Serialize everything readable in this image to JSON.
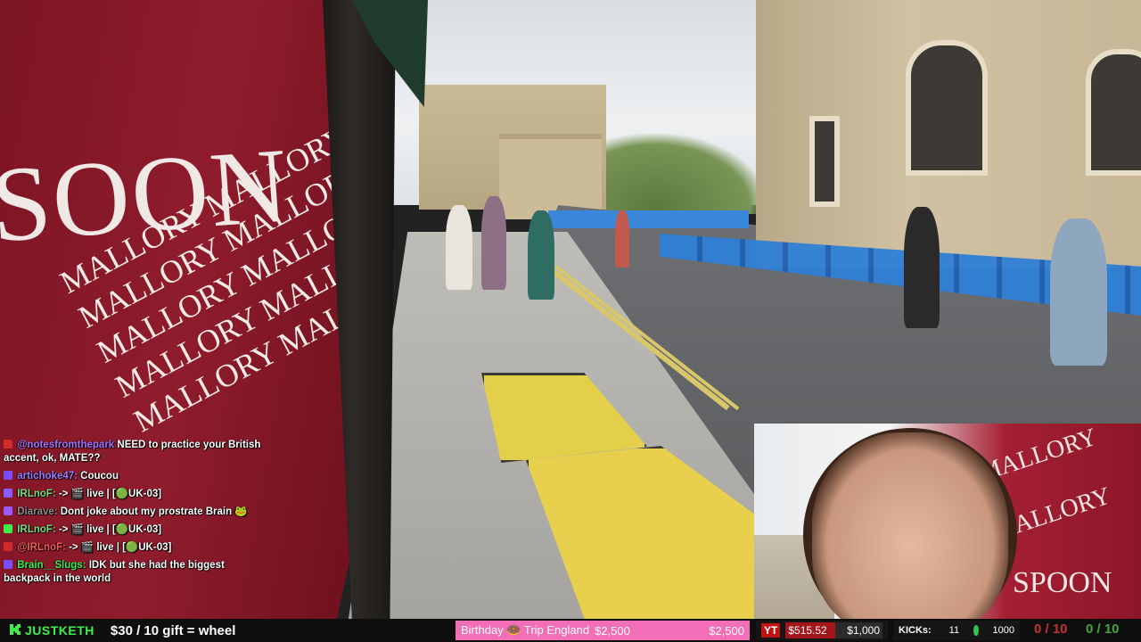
{
  "scene": {
    "ad_word": "SOON",
    "ad_row": "MALLORY MALLORY"
  },
  "webcam": {
    "wall_text_1": "MALLORY",
    "wall_text_2": "Y MALLORY",
    "wall_text_3": "SPOON"
  },
  "chat": [
    {
      "user": "@notesfromthepark",
      "user_color": "#a970ff",
      "message": "NEED to practice your British accent, ok, MATE??",
      "badge": "#d12b2b"
    },
    {
      "user": "artichoke47:",
      "user_color": "#9b7cff",
      "message": "Coucou",
      "badge": "#7a4cff"
    },
    {
      "user": "IRLnoF:",
      "user_color": "#7bdc7b",
      "message": "-> 🎬 live | [🟢UK-03]",
      "badge": "#8a5cff"
    },
    {
      "user": "Diarave:",
      "user_color": "#8b8b8b",
      "message": "Dont joke about my prostrate Brain 🐸",
      "badge": "#9b59ff"
    },
    {
      "user": "IRLnoF:",
      "user_color": "#7bdc7b",
      "message": "-> 🎬 live | [🟢UK-03]",
      "badge": "#3cf04a"
    },
    {
      "user": "@IRLnoF:",
      "user_color": "#ff5c5c",
      "message": "-> 🎬 live | [🟢UK-03]",
      "badge": "#d12b2b"
    },
    {
      "user": "Brain__Slugs:",
      "user_color": "#3cf04a",
      "message": "IDK but she had the biggest backpack in the world",
      "badge": "#7a4cff"
    }
  ],
  "bottom_bar": {
    "logo_text": "JUSTKETH",
    "gift_text": "$30 / 10 gift = wheel",
    "goal": {
      "label": "Birthday 🍩 Trip England",
      "current": "$2,500",
      "target": "$2,500",
      "color": "#f26fb8"
    },
    "yt": {
      "label": "YT",
      "current": "$515.52",
      "target": "$1,000",
      "progress": 0.5155
    },
    "kicks": {
      "label": "KICKs:",
      "value": "11",
      "goal": "1000"
    },
    "counter_red": "0 / 10",
    "counter_green": "0 / 10"
  }
}
